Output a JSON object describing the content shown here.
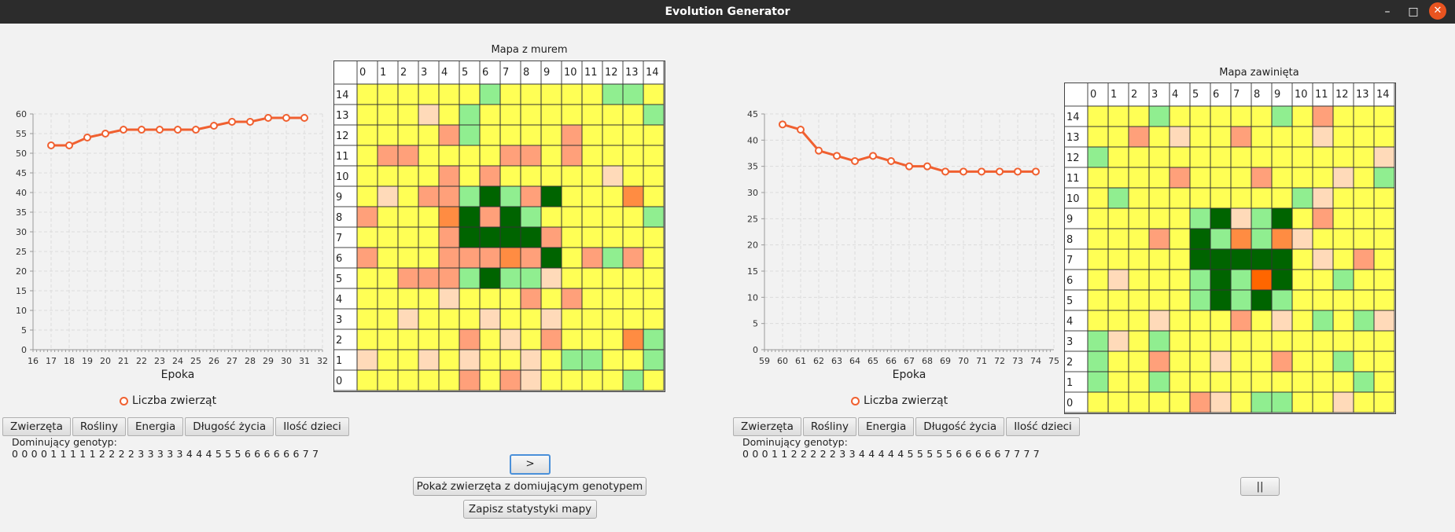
{
  "window": {
    "title": "Evolution Generator"
  },
  "colors": {
    "accent": "#f06030",
    "cell": {
      "Y": "#ffff55",
      "G": "#90ee90",
      "D": "#006400",
      "P": "#ffdab9",
      "S": "#ffa07a",
      "O": "#ff8c42",
      "R": "#ff6600"
    }
  },
  "left": {
    "chart_data": {
      "type": "line",
      "title": "",
      "xlabel": "Epoka",
      "ylabel": "",
      "xlim": [
        16,
        32
      ],
      "ylim": [
        0,
        60
      ],
      "x_ticks": [
        16,
        17,
        18,
        19,
        20,
        21,
        22,
        23,
        24,
        25,
        26,
        27,
        28,
        29,
        30,
        31,
        32
      ],
      "y_ticks": [
        0,
        5,
        10,
        15,
        20,
        25,
        30,
        35,
        40,
        45,
        50,
        55,
        60
      ],
      "grid": true,
      "legend": "bottom",
      "series": [
        {
          "name": "Liczba zwierząt",
          "x": [
            17,
            18,
            19,
            20,
            21,
            22,
            23,
            24,
            25,
            26,
            27,
            28,
            29,
            30,
            31
          ],
          "values": [
            52,
            52,
            54,
            55,
            56,
            56,
            56,
            56,
            56,
            57,
            58,
            58,
            59,
            59,
            59
          ]
        }
      ]
    },
    "legend_label": "Liczba zwierząt",
    "tabs": [
      "Zwierzęta",
      "Rośliny",
      "Energia",
      "Długość życia",
      "Ilość dzieci"
    ],
    "genotype_label": "Dominujący genotyp:",
    "genotype": "0 0 0 0 1 1 1 1 1 2 2 2 2 3 3 3 3 3 4 4 4 5 5 5 6 6 6 6 6 6 7 7"
  },
  "map1": {
    "title": "Mapa z murem",
    "columns": [
      "0",
      "1",
      "2",
      "3",
      "4",
      "5",
      "6",
      "7",
      "8",
      "9",
      "10",
      "11",
      "12",
      "13",
      "14"
    ],
    "rows": [
      "14",
      "13",
      "12",
      "11",
      "10",
      "9",
      "8",
      "7",
      "6",
      "5",
      "4",
      "3",
      "2",
      "1",
      "0"
    ],
    "grid": [
      "YYYYYYGYYYYYGGY",
      "YYYPYGYYYYYYYYG",
      "YYYYSGYYYYSYYYY",
      "YSSYYYYSSYSYYYY",
      "YYYYSYSYYYYYPYY",
      "YPYSSGDGSDYYYOY",
      "SYYYODSDGYYYYYG",
      "YYYYSDDDDSYYYYY",
      "SYYYSSSOSDYSGSY",
      "YYSSSGDGGPYYYYY",
      "YYYYPYYYSYSYYYY",
      "YYPYYYPYYPYYYYY",
      "YYYYYSYPYSYYYOG",
      "PYYPYPYYPYGGYYG",
      "YYYYYSYSPYYYYGY"
    ],
    "step_button": ">",
    "show_dominant_button": "Pokaż zwierzęta z domiującym genotypem",
    "save_stats_button": "Zapisz statystyki mapy"
  },
  "right": {
    "chart_data": {
      "type": "line",
      "title": "",
      "xlabel": "Epoka",
      "ylabel": "",
      "xlim": [
        59,
        75
      ],
      "ylim": [
        0,
        45
      ],
      "x_ticks": [
        59,
        60,
        61,
        62,
        63,
        64,
        65,
        66,
        67,
        68,
        69,
        70,
        71,
        72,
        73,
        74,
        75
      ],
      "y_ticks": [
        0,
        5,
        10,
        15,
        20,
        25,
        30,
        35,
        40,
        45
      ],
      "grid": true,
      "legend": "bottom",
      "series": [
        {
          "name": "Liczba zwierząt",
          "x": [
            60,
            61,
            62,
            63,
            64,
            65,
            66,
            67,
            68,
            69,
            70,
            71,
            72,
            73,
            74
          ],
          "values": [
            43,
            42,
            38,
            37,
            36,
            37,
            36,
            35,
            35,
            34,
            34,
            34,
            34,
            34,
            34
          ]
        }
      ]
    },
    "legend_label": "Liczba zwierząt",
    "tabs": [
      "Zwierzęta",
      "Rośliny",
      "Energia",
      "Długość życia",
      "Ilość dzieci"
    ],
    "genotype_label": "Dominujący genotyp:",
    "genotype": "0 0 0 1 1 2 2 2 2 2 3 3 4 4 4 4 4 5 5 5 5 5 6 6 6 6 6 7 7 7 7"
  },
  "map2": {
    "title": "Mapa zawinięta",
    "columns": [
      "0",
      "1",
      "2",
      "3",
      "4",
      "5",
      "6",
      "7",
      "8",
      "9",
      "10",
      "11",
      "12",
      "13",
      "14"
    ],
    "rows": [
      "14",
      "13",
      "12",
      "11",
      "10",
      "9",
      "8",
      "7",
      "6",
      "5",
      "4",
      "3",
      "2",
      "1",
      "0"
    ],
    "grid": [
      "YYYGYYYYYGYSYYY",
      "YYSYPYYSYYYPYYY",
      "GYYYYYYYYYYYYYP",
      "YYYYSYYYSYYYPYG",
      "YGYYYYYYYYGPYYY",
      "YYYYYGDPGDYSYYY",
      "YYYSYDGOGOPYYYY",
      "YYYYYDDDDDYPYSY",
      "YPYYYGDGRDYYGYY",
      "YYYYYGDGDGYYYYY",
      "YYYPYYYSYPYGYGP",
      "GPYGYYYYYYYYYYY",
      "GYYSYYPYYSYYGYY",
      "GYYGYYYYYYYYYGY",
      "YYYYYSPYGGYYPYY"
    ],
    "pause_button": "||"
  }
}
